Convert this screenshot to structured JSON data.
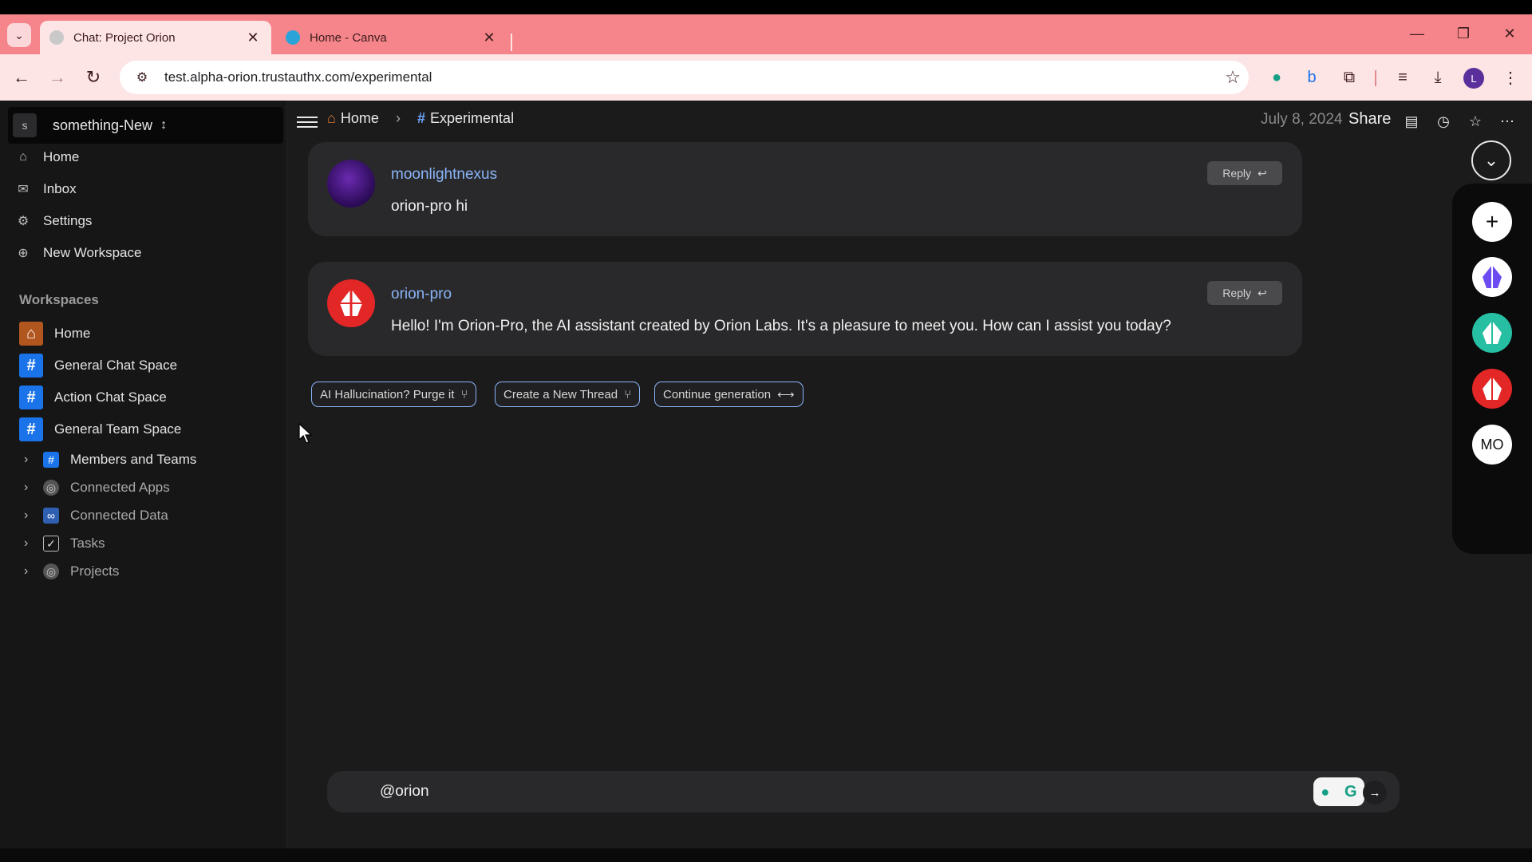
{
  "browser": {
    "tabs": [
      {
        "title": "Chat: Project Orion",
        "active": true
      },
      {
        "title": "Home - Canva",
        "active": false
      }
    ],
    "url": "test.alpha-orion.trustauthx.com/experimental",
    "profile_initial": "L"
  },
  "sidebar": {
    "workspace_avatar": "s",
    "workspace_name": "something-New",
    "nav": [
      {
        "label": "Home",
        "icon": "home-icon"
      },
      {
        "label": "Inbox",
        "icon": "inbox-icon"
      },
      {
        "label": "Settings",
        "icon": "gear-icon"
      },
      {
        "label": "New Workspace",
        "icon": "plus-circle-icon"
      }
    ],
    "workspaces_title": "Workspaces",
    "workspaces": [
      {
        "label": "Home",
        "icon": "home-icon",
        "color": "#b2561f"
      },
      {
        "label": "General Chat Space",
        "icon": "hash-icon",
        "color": "#1a73e8"
      },
      {
        "label": "Action Chat Space",
        "icon": "hash-icon",
        "color": "#1a73e8"
      },
      {
        "label": "General Team Space",
        "icon": "hash-icon",
        "color": "#1a73e8"
      }
    ],
    "tree": [
      {
        "label": "Members and Teams"
      },
      {
        "label": "Connected Apps"
      },
      {
        "label": "Connected Data"
      },
      {
        "label": "Tasks"
      },
      {
        "label": "Projects"
      }
    ]
  },
  "header": {
    "crumb_home": "Home",
    "crumb_current": "Experimental",
    "date": "July 8, 2024",
    "share": "Share"
  },
  "messages": [
    {
      "user": "moonlightnexus",
      "text": "orion-pro hi",
      "reply": "Reply"
    },
    {
      "user": "orion-pro",
      "text": "Hello! I'm Orion-Pro, the AI assistant created by Orion Labs. It's a pleasure to meet you. How can I assist you today?",
      "reply": "Reply"
    }
  ],
  "actions": [
    {
      "label": "AI Hallucination? Purge it"
    },
    {
      "label": "Create a New Thread"
    },
    {
      "label": "Continue generation"
    }
  ],
  "rail": {
    "initials": "MO"
  },
  "composer": {
    "value": "@orion"
  },
  "colors": {
    "accent": "#8ab4f8",
    "tab_bar": "#f5858a",
    "brand_red": "#e32626"
  }
}
